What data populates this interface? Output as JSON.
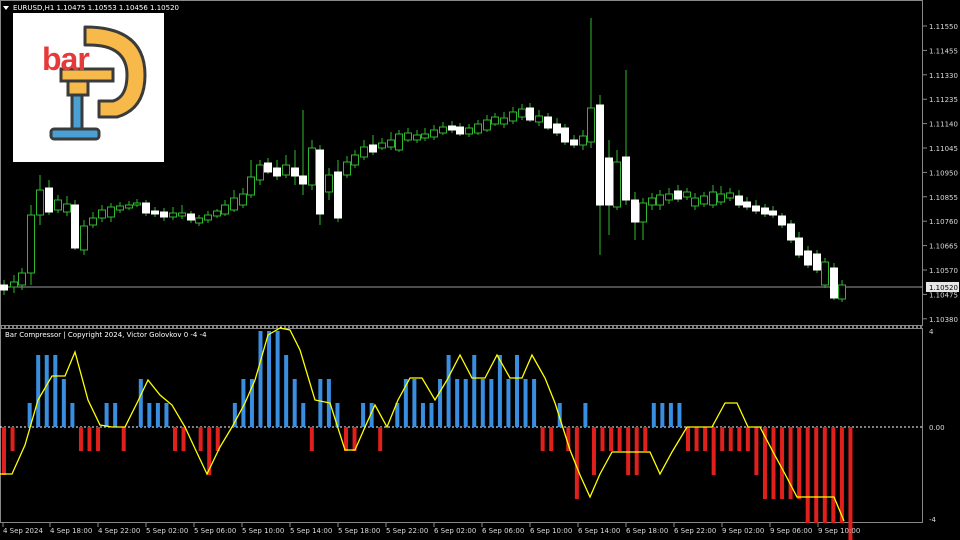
{
  "main_chart": {
    "header": "EURUSD,H1  1.10475 1.10553 1.10456 1.10520",
    "current_price": "1.10520",
    "price_labels": [
      "1.11550",
      "1.11455",
      "1.11330",
      "1.11235",
      "1.11140",
      "1.11045",
      "1.10950",
      "1.10855",
      "1.10760",
      "1.10665",
      "1.10570",
      "1.10475",
      "1.10380"
    ],
    "logo": {
      "text": "bar",
      "text_color": "#e63a3a",
      "clamp_color": "#f6b94a",
      "screw_color": "#4a9fd4"
    }
  },
  "indicator": {
    "header": "Bar Compressor | Copyright 2024, Victor Golovkov 0 -4 -4",
    "labels": {
      "top": "4",
      "zero": "0.00",
      "bottom": "-4"
    }
  },
  "time_axis": {
    "labels": [
      "4 Sep 2024",
      "4 Sep 18:00",
      "4 Sep 22:00",
      "5 Sep 02:00",
      "5 Sep 06:00",
      "5 Sep 10:00",
      "5 Sep 14:00",
      "5 Sep 18:00",
      "5 Sep 22:00",
      "6 Sep 02:00",
      "6 Sep 06:00",
      "6 Sep 10:00",
      "6 Sep 14:00",
      "6 Sep 18:00",
      "6 Sep 22:00",
      "9 Sep 02:00",
      "9 Sep 06:00",
      "9 Sep 10:00"
    ]
  },
  "colors": {
    "bull_candle": "#ffffff",
    "candle_wick": "#2fb82f",
    "hist_up": "#3a8ee0",
    "hist_down": "#e0201c",
    "signal_line": "#ffff00",
    "grid": "#ffffff"
  }
}
